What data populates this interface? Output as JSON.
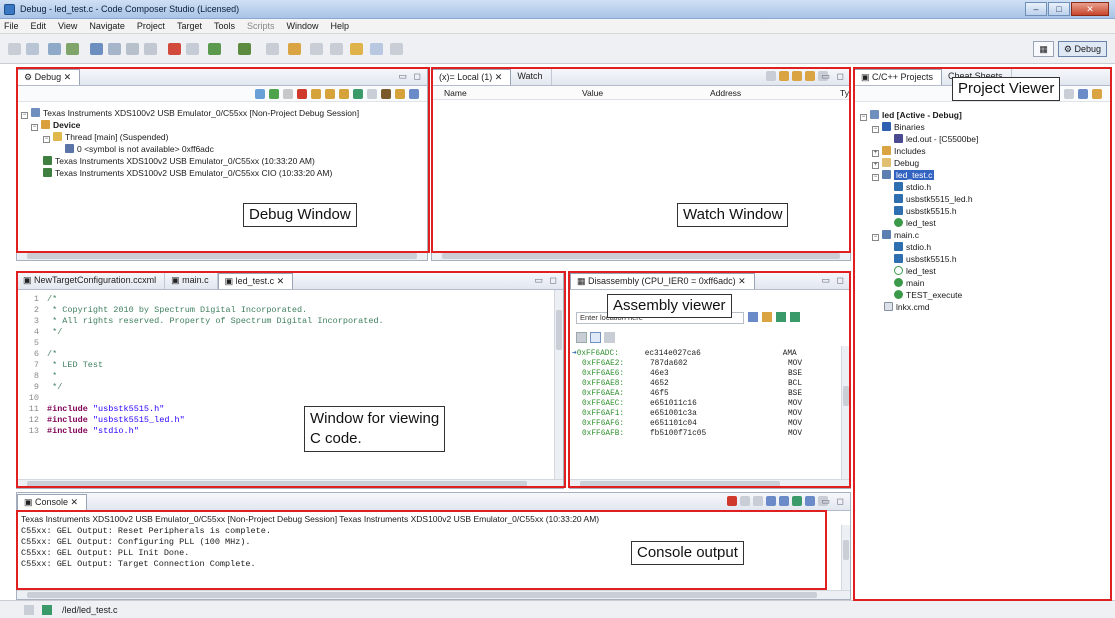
{
  "window": {
    "title": "Debug - led_test.c - Code Composer Studio (Licensed)",
    "buttons": [
      "–",
      "□",
      "✕"
    ]
  },
  "menu": [
    "File",
    "Edit",
    "View",
    "Navigate",
    "Project",
    "Target",
    "Tools",
    "Scripts",
    "Window",
    "Help"
  ],
  "perspective": {
    "label": "Debug"
  },
  "debug_view": {
    "tab": "Debug",
    "tree": [
      "Texas Instruments XDS100v2 USB Emulator_0/C55xx [Non-Project Debug Session]",
      "Device",
      "Thread [main] (Suspended)",
      "0 <symbol is not available> 0xff6adc",
      "Texas Instruments XDS100v2 USB Emulator_0/C55xx (10:33:20 AM)",
      "Texas Instruments XDS100v2 USB Emulator_0/C55xx CIO (10:33:20 AM)"
    ]
  },
  "watch_view": {
    "tabs": [
      "(x)= Local (1)",
      "Watch"
    ],
    "columns": [
      "Name",
      "Value",
      "Address",
      "Ty"
    ]
  },
  "project_view": {
    "tabs": [
      "C/C++ Projects",
      "Cheat Sheets"
    ],
    "tree": [
      "led [Active - Debug]",
      "Binaries",
      "led.out - [C5500be]",
      "Includes",
      "Debug",
      "led_test.c",
      "stdio.h",
      "usbstk5515_led.h",
      "usbstk5515.h",
      "led_test",
      "main.c",
      "stdio.h",
      "usbstk5515.h",
      "led_test",
      "main",
      "TEST_execute",
      "lnkx.cmd"
    ]
  },
  "editor": {
    "tabs": [
      "NewTargetConfiguration.ccxml",
      "main.c",
      "led_test.c"
    ],
    "lines": [
      {
        "n": "1",
        "t": "/*"
      },
      {
        "n": "2",
        "t": " *  Copyright 2010 by Spectrum Digital Incorporated."
      },
      {
        "n": "3",
        "t": " *  All rights reserved. Property of Spectrum Digital Incorporated."
      },
      {
        "n": "4",
        "t": " */"
      },
      {
        "n": "5",
        "t": ""
      },
      {
        "n": "6",
        "t": "/*"
      },
      {
        "n": "7",
        "t": " *  LED Test"
      },
      {
        "n": "8",
        "t": " *"
      },
      {
        "n": "9",
        "t": " */"
      },
      {
        "n": "10",
        "t": ""
      },
      {
        "n": "11",
        "kw": "#include",
        "s": " \"usbstk5515.h\""
      },
      {
        "n": "12",
        "kw": "#include",
        "s": " \"usbstk5515_led.h\""
      },
      {
        "n": "13",
        "kw": "#include",
        "s": " \"stdio.h\""
      }
    ]
  },
  "disassembly": {
    "tab": "Disassembly (CPU_IER0 = 0xff6adc)",
    "location_placeholder": "Enter location here",
    "rows": [
      {
        "a": "0xFF6ADC:",
        "o": "ec314e027ca6",
        "m": "AMA"
      },
      {
        "a": "0xFF6AE2:",
        "o": "787da602",
        "m": "MOV"
      },
      {
        "a": "0xFF6AE6:",
        "o": "46e3",
        "m": "BSE"
      },
      {
        "a": "0xFF6AE8:",
        "o": "4652",
        "m": "BCL"
      },
      {
        "a": "0xFF6AEA:",
        "o": "46f5",
        "m": "BSE"
      },
      {
        "a": "0xFF6AEC:",
        "o": "e651011c16",
        "m": "MOV"
      },
      {
        "a": "0xFF6AF1:",
        "o": "e651001c3a",
        "m": "MOV"
      },
      {
        "a": "0xFF6AF6:",
        "o": "e651101c04",
        "m": "MOV"
      },
      {
        "a": "0xFF6AFB:",
        "o": "fb5100f71c05",
        "m": "MOV"
      }
    ]
  },
  "console": {
    "tab": "Console",
    "header": "Texas Instruments XDS100v2 USB Emulator_0/C55xx [Non-Project Debug Session] Texas Instruments XDS100v2 USB Emulator_0/C55xx (10:33:20 AM)",
    "lines": [
      "C55xx: GEL Output: Reset Peripherals is complete.",
      "C55xx: GEL Output: Configuring PLL (100 MHz).",
      "C55xx: GEL Output: PLL Init Done.",
      "C55xx: GEL Output: Target Connection Complete."
    ]
  },
  "status_bar": {
    "path": "/led/led_test.c"
  },
  "annotations": {
    "debug": "Debug Window",
    "watch": "Watch Window",
    "project": "Project Viewer",
    "assembly": "Assembly viewer",
    "code_line1": "Window for viewing",
    "code_line2": "C code.",
    "console": "Console output"
  }
}
